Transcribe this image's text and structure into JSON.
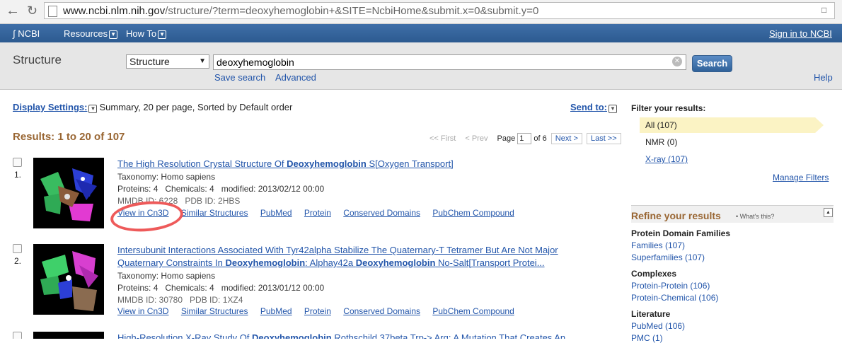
{
  "browser": {
    "url_host": "www.ncbi.nlm.nih.gov",
    "url_path": "/structure/?term=deoxyhemoglobin+&SITE=NcbiHome&submit.x=0&submit.y=0"
  },
  "ncbi_bar": {
    "logo": "NCBI",
    "resources": "Resources",
    "howto": "How To",
    "signin": "Sign in to NCBI"
  },
  "search": {
    "db_title": "Structure",
    "db_selected": "Structure",
    "query": "deoxyhemoglobin",
    "button": "Search",
    "save_search": "Save search",
    "advanced": "Advanced",
    "help": "Help"
  },
  "display": {
    "label": "Display Settings:",
    "summary": "Summary, 20 per page, Sorted by Default order",
    "send_to": "Send to:"
  },
  "results_count": "Results: 1 to 20 of 107",
  "pager": {
    "first": "<< First",
    "prev": "< Prev",
    "page_label": "Page",
    "page_value": "1",
    "of": "of 6",
    "next": "Next >",
    "last": "Last >>"
  },
  "results": [
    {
      "num": "1.",
      "title_pre": "The High Resolution Crystal Structure Of ",
      "title_bold": "Deoxyhemoglobin",
      "title_post": " S[Oxygen Transport]",
      "taxonomy": "Taxonomy: Homo sapiens",
      "meta": "Proteins: 4   Chemicals: 4   modified: 2013/02/12 00:00",
      "ids": "MMDB ID: 6228   PDB ID: 2HBS",
      "links": [
        "View in Cn3D",
        "Similar Structures",
        "PubMed",
        "Protein",
        "Conserved Domains",
        "PubChem Compound"
      ]
    },
    {
      "num": "2.",
      "title_line1": "Intersubunit Interactions Associated With Tyr42alpha Stabilize The Quaternary-T Tetramer But Are Not Major",
      "title_line2_a": "Quaternary Constraints In ",
      "title_line2_b": "Deoxyhemoglobin",
      "title_line2_c": ": Alphay42a ",
      "title_line2_d": "Deoxyhemoglobin",
      "title_line2_e": " No-Salt[Transport Protei...",
      "taxonomy": "Taxonomy: Homo sapiens",
      "meta": "Proteins: 4   Chemicals: 4   modified: 2013/01/12 00:00",
      "ids": "MMDB ID: 30780   PDB ID: 1XZ4",
      "links": [
        "View in Cn3D",
        "Similar Structures",
        "PubMed",
        "Protein",
        "Conserved Domains",
        "PubChem Compound"
      ]
    },
    {
      "title_pre": "High-Resolution X-Ray Study Of ",
      "title_bold": "Deoxyhemoglobin",
      "title_post": " Rothschild 37beta Trp-> Arg: A Mutation That Creates An"
    }
  ],
  "sidebar": {
    "filter_title": "Filter your results:",
    "filters": [
      "All (107)",
      "NMR (0)",
      "X-ray (107)"
    ],
    "manage": "Manage Filters",
    "refine_title": "Refine your results",
    "whats_this": "What's this?",
    "groups": [
      {
        "heading": "Protein Domain Families",
        "items": [
          "Families (107)",
          "Superfamilies (107)"
        ]
      },
      {
        "heading": "Complexes",
        "items": [
          "Protein-Protein (106)",
          "Protein-Chemical (106)"
        ]
      },
      {
        "heading": "Literature",
        "items": [
          "PubMed (106)",
          "PMC (1)"
        ]
      }
    ]
  },
  "colors": {
    "ncbi_bar": "#336699",
    "results_count": "#996633",
    "link": "#2255aa",
    "annotation": "#ee5a5a",
    "filter_highlight": "#fbf3c4"
  }
}
